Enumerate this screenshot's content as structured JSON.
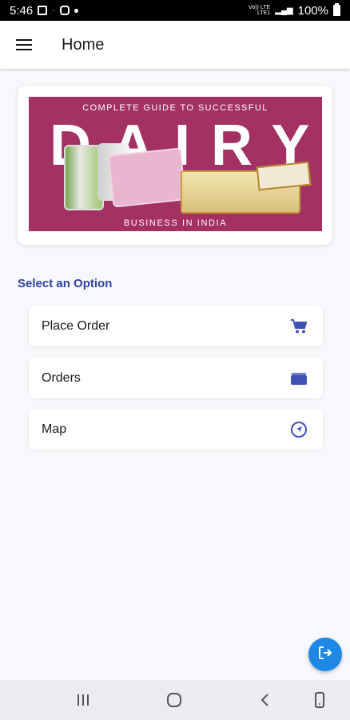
{
  "status_bar": {
    "time": "5:46",
    "network": "Vo)) LTE LTE1",
    "battery": "100%"
  },
  "app_bar": {
    "title": "Home",
    "menu_icon": "hamburger-menu-icon"
  },
  "banner": {
    "top_text": "COMPLETE GUIDE TO SUCCESSFUL",
    "headline": "DAIRY",
    "bottom_text": "BUSINESS IN INDIA",
    "background_color": "#a33164"
  },
  "section": {
    "title": "Select an Option",
    "color": "#2f3fa5"
  },
  "options": [
    {
      "label": "Place Order",
      "icon": "cart-icon"
    },
    {
      "label": "Orders",
      "icon": "orders-folder-icon"
    },
    {
      "label": "Map",
      "icon": "navigation-icon"
    }
  ],
  "fab": {
    "icon": "logout-icon",
    "color": "#1e88e5"
  },
  "nav_bar": {
    "items": [
      "recent-apps-icon",
      "home-icon",
      "back-icon",
      "screenshot-icon"
    ]
  }
}
